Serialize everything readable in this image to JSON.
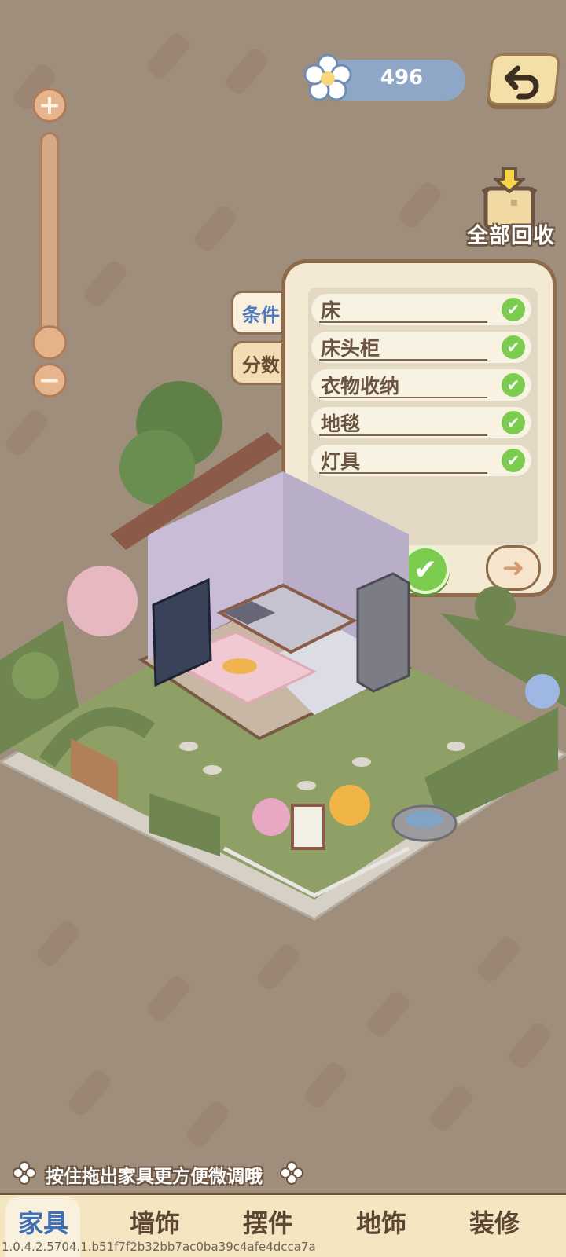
{
  "currency": {
    "value": "496",
    "icon": "flower-icon"
  },
  "recycle": {
    "label": "全部回收",
    "icon": "recycle-basket-icon"
  },
  "zoom": {
    "level": 0.18
  },
  "side_tabs": {
    "conditions": "条件",
    "score": "分数"
  },
  "conditions": {
    "items": [
      {
        "label": "床",
        "done": "✔"
      },
      {
        "label": "床头柜",
        "done": "✔"
      },
      {
        "label": "衣物收纳",
        "done": "✔"
      },
      {
        "label": "地毯",
        "done": "✔"
      },
      {
        "label": "灯具",
        "done": "✔"
      }
    ],
    "confirm_icon": "check-icon",
    "next_icon": "arrow-right-icon"
  },
  "hint": "按住拖出家具更方便微调哦",
  "bottom_tabs": {
    "active": "家具",
    "wall": "墙饰",
    "ornament": "摆件",
    "floor": "地饰",
    "decor": "装修"
  },
  "version": "1.0.4.2.5704.1.b51f7f2b32bb7ac0ba39c4afe4dcca7a",
  "colors": {
    "background": "#a08e7c",
    "accent_green": "#7ccc4f",
    "accent_blue": "#3e6fb7"
  }
}
